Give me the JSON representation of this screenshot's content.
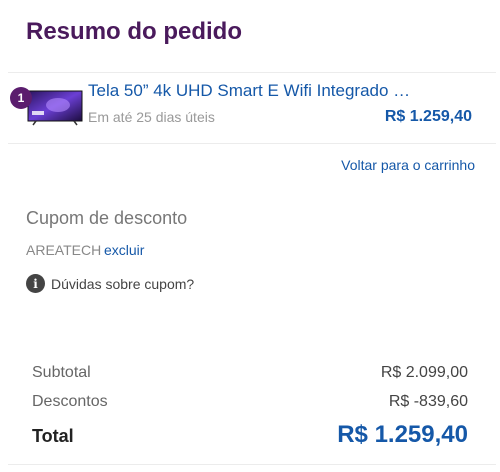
{
  "order_summary": {
    "title": "Resumo do pedido",
    "item": {
      "quantity": "1",
      "name": "Tela 50” 4k UHD Smart E Wifi Integrado …",
      "delivery": "Em até 25 dias úteis",
      "price": "R$ 1.259,40",
      "thumbnail_icon": "tv-thumbnail-icon"
    },
    "back_to_cart": "Voltar para o carrinho",
    "coupon": {
      "title": "Cupom de desconto",
      "code": "AREATECH",
      "remove_label": "excluir",
      "help_label": "Dúvidas sobre cupom?",
      "help_icon": "info-icon"
    },
    "totals": {
      "subtotal_label": "Subtotal",
      "subtotal_value": "R$ 2.099,00",
      "discount_label": "Descontos",
      "discount_value": "R$ -839,60",
      "total_label": "Total",
      "total_value": "R$ 1.259,40"
    },
    "colors": {
      "title": "#4a1a5c",
      "link": "#1558a8",
      "badge": "#5b1d6e"
    }
  }
}
